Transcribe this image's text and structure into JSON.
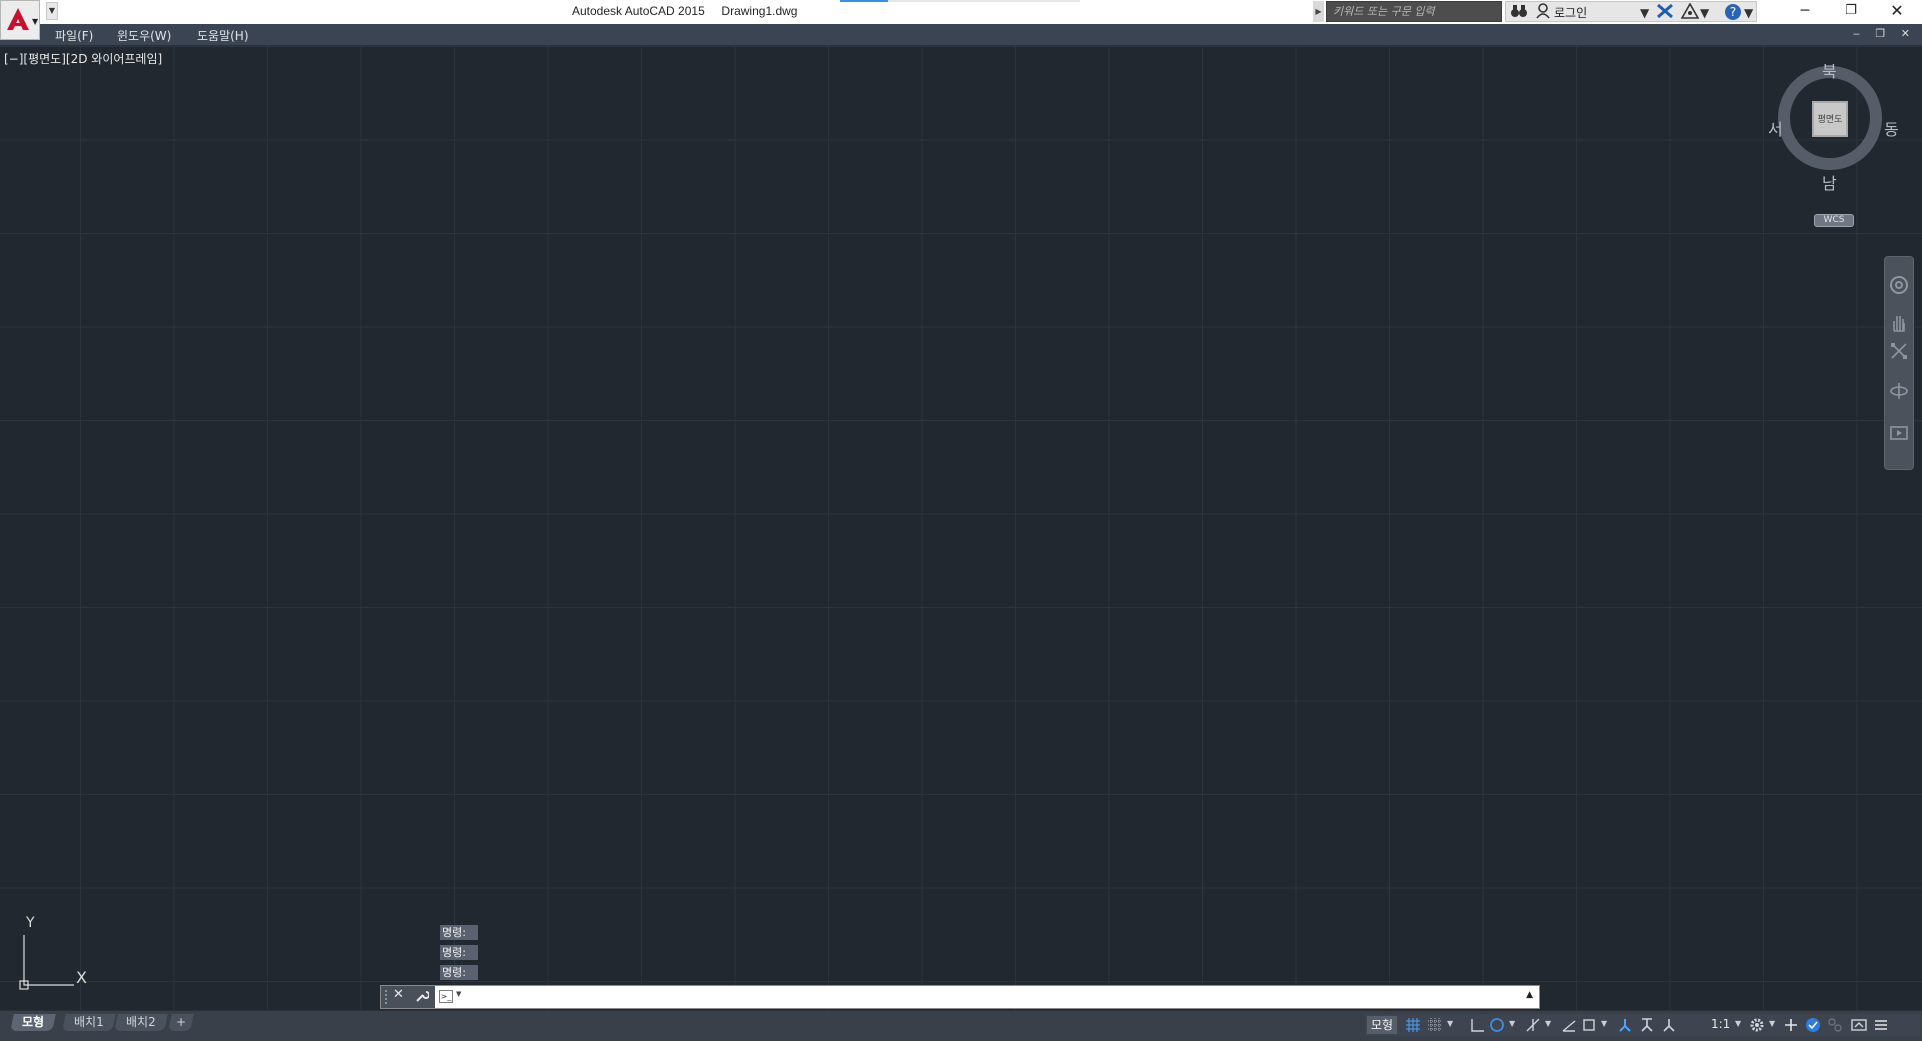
{
  "window": {
    "title": "Autodesk AutoCAD 2015     Drawing1.dwg",
    "search_placeholder": "키워드 또는 구문 입력",
    "login_label": "로그인",
    "minimize": "─",
    "restore": "❐",
    "close": "✕"
  },
  "menu": {
    "file": "파일(F)",
    "window": "윈도우(W)",
    "help": "도움말(H)",
    "doc_controls": "‒ ❐ ✕"
  },
  "viewport": {
    "label": "[−][평면도][2D 와이어프레임]"
  },
  "viewcube": {
    "north": "북",
    "south": "남",
    "west": "서",
    "east": "동",
    "face": "평면도",
    "wcs": "WCS"
  },
  "ucs": {
    "x": "X",
    "y": "Y"
  },
  "command": {
    "history": [
      "명령:",
      "명령:",
      "명령:"
    ],
    "input_value": ""
  },
  "layout_tabs": [
    "모형",
    "배치1",
    "배치2",
    "+"
  ],
  "status": {
    "model_label": "모형",
    "scale": "1:1"
  },
  "colors": {
    "background": "#212830",
    "grid": "#2c3440",
    "accent": "#3d8de0",
    "logo_red": "#c8102e"
  }
}
